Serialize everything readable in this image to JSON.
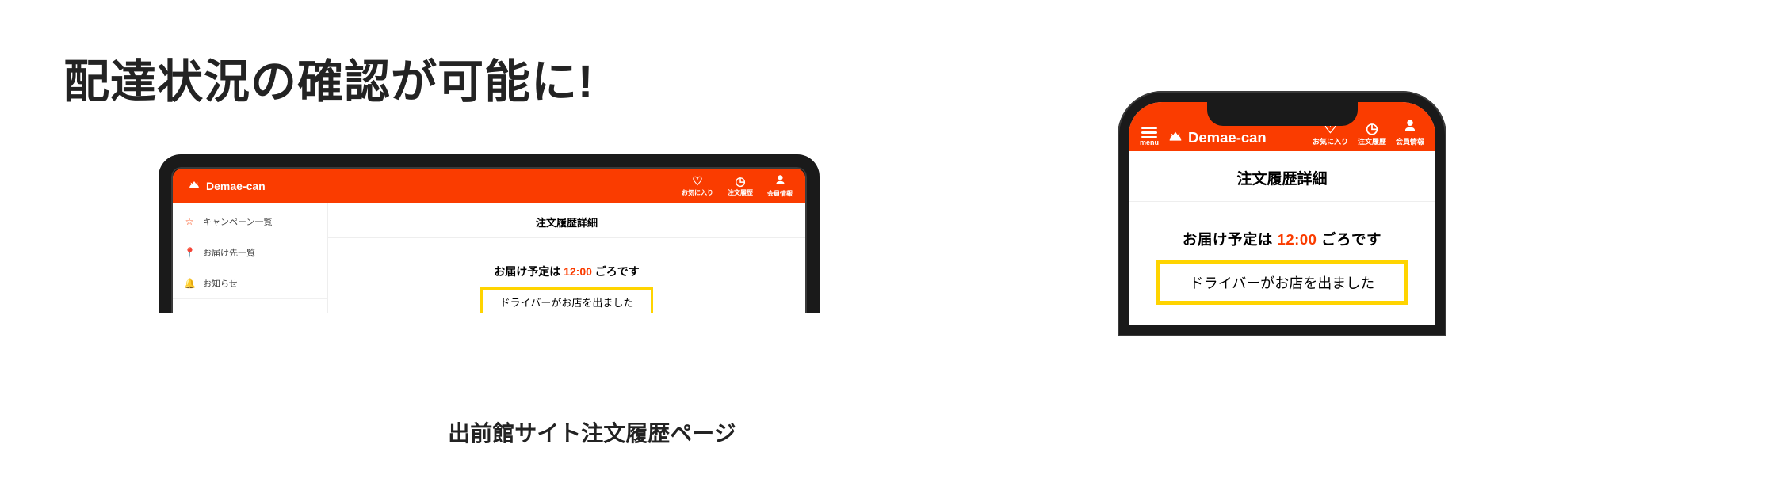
{
  "headline": "配達状況の確認が可能に!",
  "caption": "出前館サイト注文履歴ページ",
  "brand_name": "Demae-can",
  "header_icons": {
    "menu_label": "menu",
    "favorites": "お気に入り",
    "history": "注文履歴",
    "account": "会員情報"
  },
  "sidebar": [
    {
      "icon": "star-icon",
      "glyph": "☆",
      "label": "キャンペーン一覧"
    },
    {
      "icon": "pin-icon",
      "glyph": "📍",
      "label": "お届け先一覧"
    },
    {
      "icon": "bell-icon",
      "glyph": "🔔",
      "label": "お知らせ"
    }
  ],
  "page_title": "注文履歴詳細",
  "eta": {
    "prefix": "お届け予定は",
    "time": "12:00",
    "suffix": "ごろです"
  },
  "status_text": "ドライバーがお店を出ました"
}
